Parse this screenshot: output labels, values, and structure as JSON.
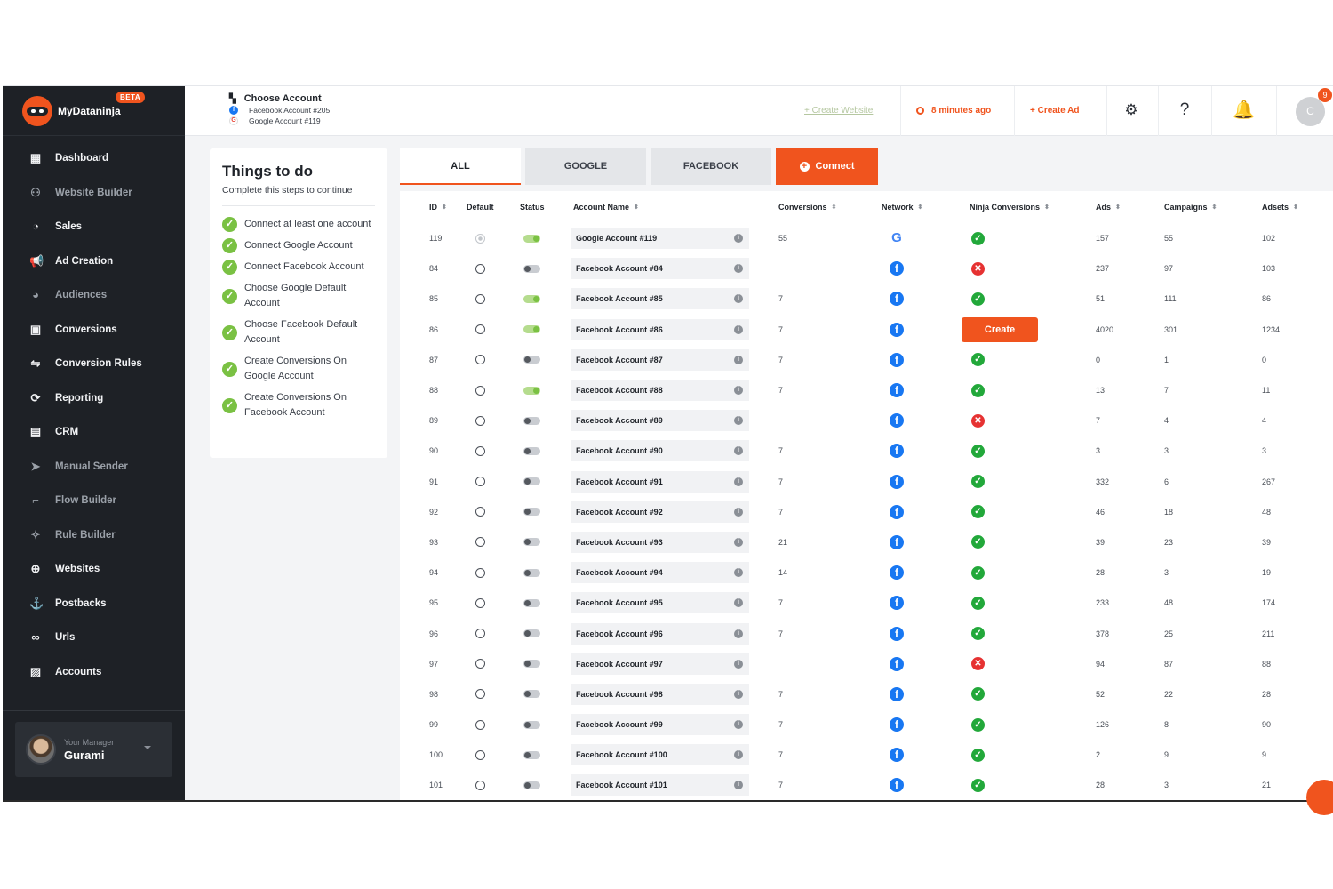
{
  "brand": {
    "name": "MyDataninja",
    "badge": "BETA",
    "accent": "#f0541e"
  },
  "sidebar": {
    "items": [
      {
        "label": "Dashboard",
        "icon": "grid-icon",
        "glyph": "▦",
        "dim": false
      },
      {
        "label": "Website Builder",
        "icon": "globe-person-icon",
        "glyph": "⚇",
        "dim": true
      },
      {
        "label": "Sales",
        "icon": "gauge-icon",
        "glyph": "◔",
        "dim": false
      },
      {
        "label": "Ad Creation",
        "icon": "megaphone-icon",
        "glyph": "📢",
        "dim": false
      },
      {
        "label": "Audiences",
        "icon": "pie-icon",
        "glyph": "◕",
        "dim": true
      },
      {
        "label": "Conversions",
        "icon": "monitor-icon",
        "glyph": "▣",
        "dim": false
      },
      {
        "label": "Conversion Rules",
        "icon": "rules-icon",
        "glyph": "⇋",
        "dim": false
      },
      {
        "label": "Reporting",
        "icon": "refresh-icon",
        "glyph": "⟳",
        "dim": false
      },
      {
        "label": "CRM",
        "icon": "save-icon",
        "glyph": "▤",
        "dim": false
      },
      {
        "label": "Manual Sender",
        "icon": "paper-plane-icon",
        "glyph": "➤",
        "dim": true
      },
      {
        "label": "Flow Builder",
        "icon": "flow-icon",
        "glyph": "⌐",
        "dim": true
      },
      {
        "label": "Rule Builder",
        "icon": "network-icon",
        "glyph": "✧",
        "dim": true
      },
      {
        "label": "Websites",
        "icon": "globe-icon",
        "glyph": "⊕",
        "dim": false
      },
      {
        "label": "Postbacks",
        "icon": "anchor-icon",
        "glyph": "⚓",
        "dim": false
      },
      {
        "label": "Urls",
        "icon": "link-icon",
        "glyph": "∞",
        "dim": false
      },
      {
        "label": "Accounts",
        "icon": "accounts-icon",
        "glyph": "▨",
        "dim": false
      }
    ],
    "manager": {
      "label": "Your Manager",
      "name": "Gurami"
    }
  },
  "header": {
    "choose_title": "Choose Account",
    "facebook_account": "Facebook Account #205",
    "google_account": "Google Account #119",
    "create_website": "+ Create Website",
    "time_ago": "8 minutes ago",
    "create_ad": "+ Create Ad",
    "user_initial": "C",
    "notification_count": "9"
  },
  "todo": {
    "title": "Things to do",
    "subtitle": "Complete this steps to continue",
    "items": [
      "Connect at least one account",
      "Connect Google Account",
      "Connect Facebook Account",
      "Choose Google Default Account",
      "Choose Facebook Default Account",
      "Create Conversions On Google Account",
      "Create Conversions On Facebook Account"
    ]
  },
  "tabs": {
    "all": "ALL",
    "google": "GOOGLE",
    "facebook": "FACEBOOK",
    "connect": "Connect"
  },
  "table": {
    "headers": {
      "id": "ID",
      "default": "Default",
      "status": "Status",
      "name": "Account Name",
      "conversions": "Conversions",
      "network": "Network",
      "ninja": "Ninja Conversions",
      "ads": "Ads",
      "campaigns": "Campaigns",
      "adsets": "Adsets"
    },
    "create_label": "Create",
    "rows": [
      {
        "id": "119",
        "default": true,
        "status": true,
        "name": "Google Account #119",
        "conversions": "55",
        "network": "google",
        "ninja": "ok",
        "ads": "157",
        "campaigns": "55",
        "adsets": "102"
      },
      {
        "id": "84",
        "default": false,
        "status": false,
        "name": "Facebook Account #84",
        "conversions": "",
        "network": "facebook",
        "ninja": "err",
        "ads": "237",
        "campaigns": "97",
        "adsets": "103"
      },
      {
        "id": "85",
        "default": false,
        "status": true,
        "name": "Facebook Account #85",
        "conversions": "7",
        "network": "facebook",
        "ninja": "ok",
        "ads": "51",
        "campaigns": "111",
        "adsets": "86"
      },
      {
        "id": "86",
        "default": false,
        "status": true,
        "name": "Facebook Account #86",
        "conversions": "7",
        "network": "facebook",
        "ninja": "create",
        "ads": "4020",
        "campaigns": "301",
        "adsets": "1234"
      },
      {
        "id": "87",
        "default": false,
        "status": false,
        "name": "Facebook Account #87",
        "conversions": "7",
        "network": "facebook",
        "ninja": "ok",
        "ads": "0",
        "campaigns": "1",
        "adsets": "0"
      },
      {
        "id": "88",
        "default": false,
        "status": true,
        "name": "Facebook Account #88",
        "conversions": "7",
        "network": "facebook",
        "ninja": "ok",
        "ads": "13",
        "campaigns": "7",
        "adsets": "11"
      },
      {
        "id": "89",
        "default": false,
        "status": false,
        "name": "Facebook Account #89",
        "conversions": "",
        "network": "facebook",
        "ninja": "err",
        "ads": "7",
        "campaigns": "4",
        "adsets": "4"
      },
      {
        "id": "90",
        "default": false,
        "status": false,
        "name": "Facebook Account #90",
        "conversions": "7",
        "network": "facebook",
        "ninja": "ok",
        "ads": "3",
        "campaigns": "3",
        "adsets": "3"
      },
      {
        "id": "91",
        "default": false,
        "status": false,
        "name": "Facebook Account #91",
        "conversions": "7",
        "network": "facebook",
        "ninja": "ok",
        "ads": "332",
        "campaigns": "6",
        "adsets": "267"
      },
      {
        "id": "92",
        "default": false,
        "status": false,
        "name": "Facebook Account #92",
        "conversions": "7",
        "network": "facebook",
        "ninja": "ok",
        "ads": "46",
        "campaigns": "18",
        "adsets": "48"
      },
      {
        "id": "93",
        "default": false,
        "status": false,
        "name": "Facebook Account #93",
        "conversions": "21",
        "network": "facebook",
        "ninja": "ok",
        "ads": "39",
        "campaigns": "23",
        "adsets": "39"
      },
      {
        "id": "94",
        "default": false,
        "status": false,
        "name": "Facebook Account #94",
        "conversions": "14",
        "network": "facebook",
        "ninja": "ok",
        "ads": "28",
        "campaigns": "3",
        "adsets": "19"
      },
      {
        "id": "95",
        "default": false,
        "status": false,
        "name": "Facebook Account #95",
        "conversions": "7",
        "network": "facebook",
        "ninja": "ok",
        "ads": "233",
        "campaigns": "48",
        "adsets": "174"
      },
      {
        "id": "96",
        "default": false,
        "status": false,
        "name": "Facebook Account #96",
        "conversions": "7",
        "network": "facebook",
        "ninja": "ok",
        "ads": "378",
        "campaigns": "25",
        "adsets": "211"
      },
      {
        "id": "97",
        "default": false,
        "status": false,
        "name": "Facebook Account #97",
        "conversions": "",
        "network": "facebook",
        "ninja": "err",
        "ads": "94",
        "campaigns": "87",
        "adsets": "88"
      },
      {
        "id": "98",
        "default": false,
        "status": false,
        "name": "Facebook Account #98",
        "conversions": "7",
        "network": "facebook",
        "ninja": "ok",
        "ads": "52",
        "campaigns": "22",
        "adsets": "28"
      },
      {
        "id": "99",
        "default": false,
        "status": false,
        "name": "Facebook Account #99",
        "conversions": "7",
        "network": "facebook",
        "ninja": "ok",
        "ads": "126",
        "campaigns": "8",
        "adsets": "90"
      },
      {
        "id": "100",
        "default": false,
        "status": false,
        "name": "Facebook Account #100",
        "conversions": "7",
        "network": "facebook",
        "ninja": "ok",
        "ads": "2",
        "campaigns": "9",
        "adsets": "9"
      },
      {
        "id": "101",
        "default": false,
        "status": false,
        "name": "Facebook Account #101",
        "conversions": "7",
        "network": "facebook",
        "ninja": "ok",
        "ads": "28",
        "campaigns": "3",
        "adsets": "21"
      }
    ]
  }
}
